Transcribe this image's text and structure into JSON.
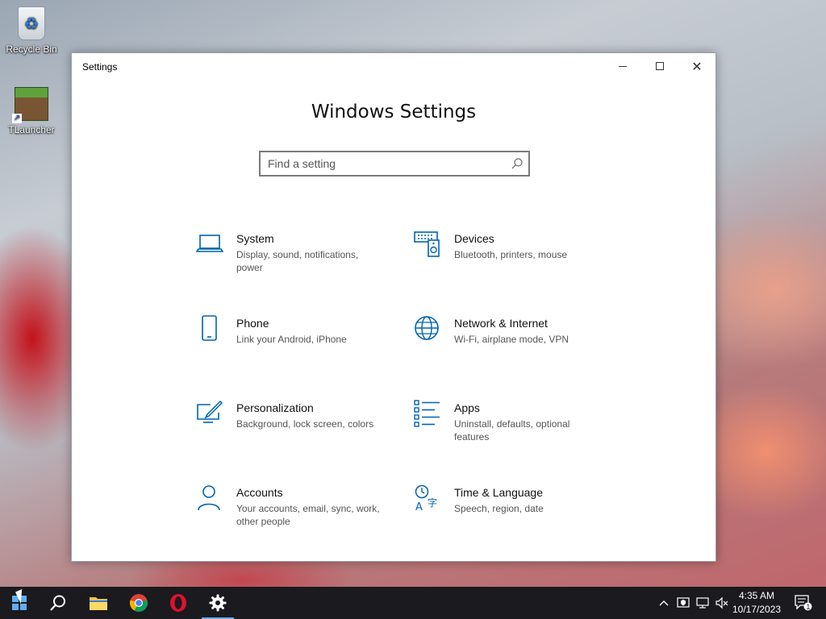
{
  "desktop": {
    "icons": [
      {
        "label": "Recycle Bin"
      },
      {
        "label": "TLauncher"
      }
    ]
  },
  "window": {
    "title": "Settings",
    "heading": "Windows Settings",
    "search": {
      "placeholder": "Find a setting"
    },
    "categories": [
      {
        "name": "System",
        "description": "Display, sound, notifications, power",
        "icon": "laptop-icon"
      },
      {
        "name": "Devices",
        "description": "Bluetooth, printers, mouse",
        "icon": "keyboard-speaker-icon"
      },
      {
        "name": "Phone",
        "description": "Link your Android, iPhone",
        "icon": "phone-icon"
      },
      {
        "name": "Network & Internet",
        "description": "Wi-Fi, airplane mode, VPN",
        "icon": "globe-icon"
      },
      {
        "name": "Personalization",
        "description": "Background, lock screen, colors",
        "icon": "paint-monitor-icon"
      },
      {
        "name": "Apps",
        "description": "Uninstall, defaults, optional features",
        "icon": "apps-list-icon"
      },
      {
        "name": "Accounts",
        "description": "Your accounts, email, sync, work, other people",
        "icon": "person-icon"
      },
      {
        "name": "Time & Language",
        "description": "Speech, region, date",
        "icon": "time-language-icon"
      }
    ],
    "accent_color": "#0063b1"
  },
  "taskbar": {
    "clock": {
      "time": "4:35 AM",
      "date": "10/17/2023"
    },
    "notification_count": "1"
  }
}
